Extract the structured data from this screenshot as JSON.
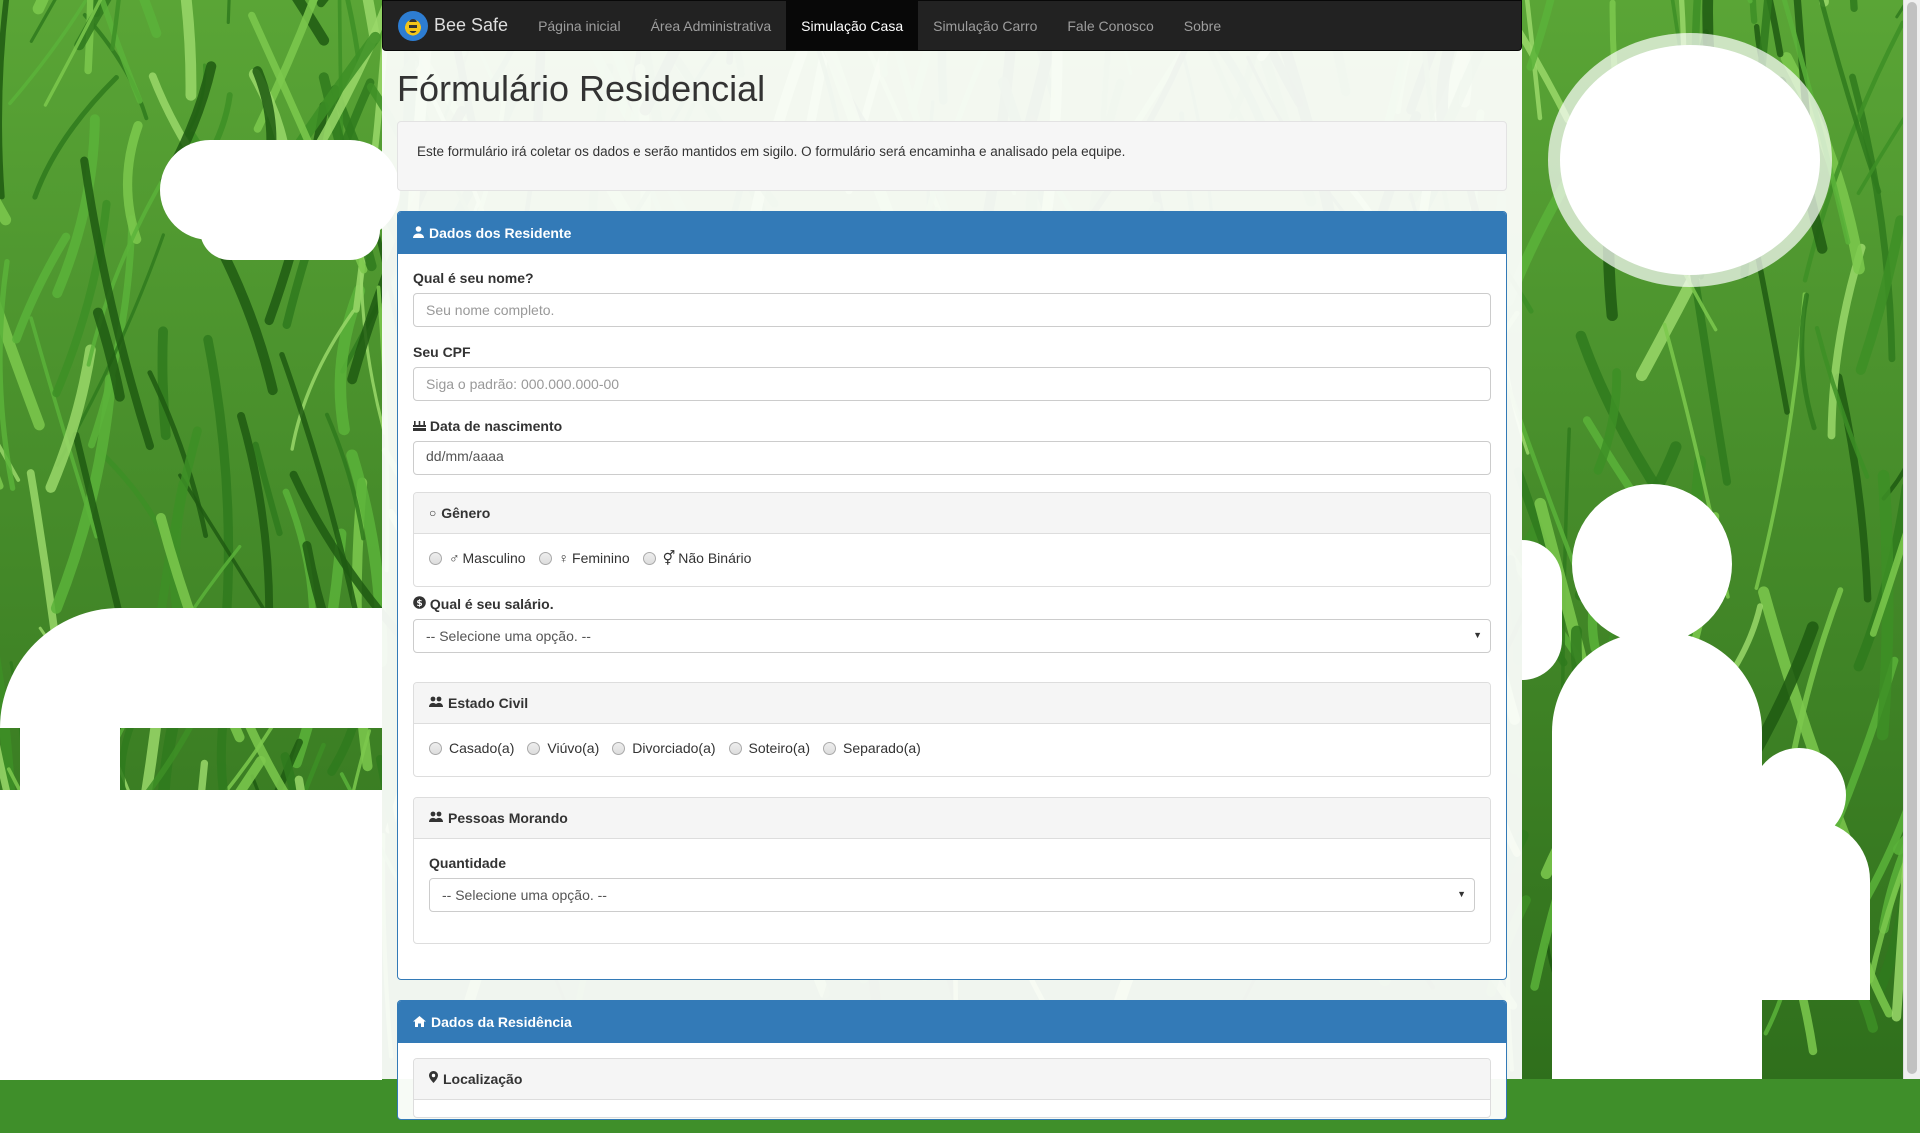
{
  "nav": {
    "brand": "Bee Safe",
    "items": [
      {
        "label": "Página inicial",
        "active": false
      },
      {
        "label": "Área Administrativa",
        "active": false
      },
      {
        "label": "Simulação Casa",
        "active": true
      },
      {
        "label": "Simulação Carro",
        "active": false
      },
      {
        "label": "Fale Conosco",
        "active": false
      },
      {
        "label": "Sobre",
        "active": false
      }
    ]
  },
  "page": {
    "title": "Fórmulário Residencial",
    "notice": "Este formulário irá coletar os dados e serão mantidos em sigilo. O formulário será encaminha e analisado pela equipe."
  },
  "residente": {
    "heading": "Dados dos Residente",
    "nome_label": "Qual é seu nome?",
    "nome_placeholder": "Seu nome completo.",
    "cpf_label": "Seu CPF",
    "cpf_placeholder": "Siga o padrão: 000.000.000-00",
    "nascimento_label": "Data de nascimento",
    "nascimento_value": "dd/mm/aaaa",
    "genero": {
      "heading": "Gênero",
      "options": [
        {
          "symbol": "♂",
          "label": "Masculino"
        },
        {
          "symbol": "♀",
          "label": "Feminino"
        },
        {
          "symbol": "⚥",
          "label": "Não Binário"
        }
      ]
    },
    "salario_label": "Qual é seu salário.",
    "salario_value": "-- Selecione uma opção. --",
    "estado_civil": {
      "heading": "Estado Civil",
      "options": [
        "Casado(a)",
        "Viúvo(a)",
        "Divorciado(a)",
        "Soteiro(a)",
        "Separado(a)"
      ]
    },
    "pessoas": {
      "heading": "Pessoas Morando",
      "quantidade_label": "Quantidade",
      "quantidade_value": "-- Selecione uma opção. --"
    }
  },
  "residencia": {
    "heading": "Dados da Residência",
    "localizacao_label": "Localização"
  },
  "colors": {
    "primary": "#337ab7",
    "navbar": "#222222",
    "grass": "#3f8f2a"
  }
}
